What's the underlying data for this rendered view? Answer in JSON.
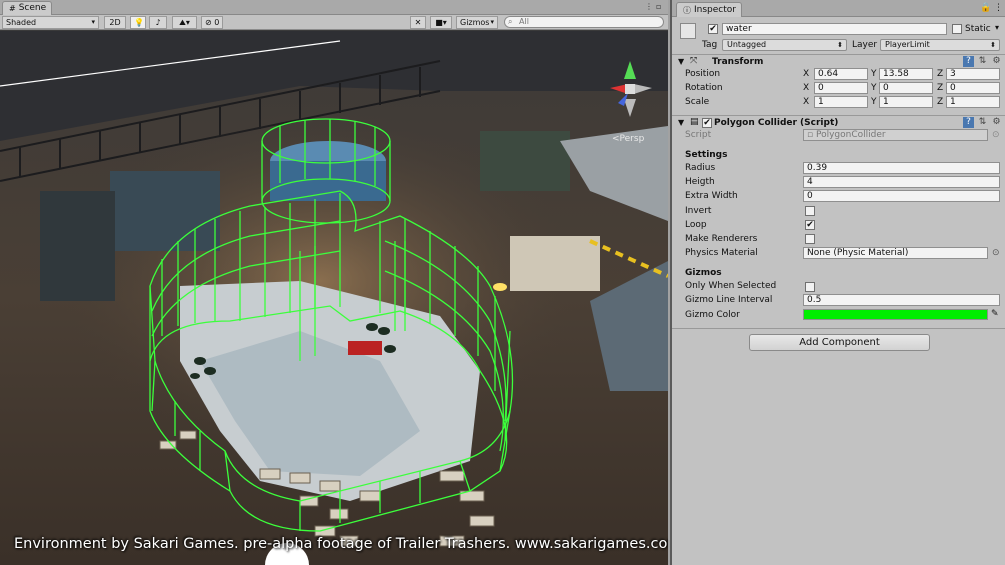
{
  "scene": {
    "tab_label": "Scene",
    "toolbar": {
      "shading_mode": "Shaded",
      "mode_2d": "2D",
      "fx_count": "0",
      "gizmos_label": "Gizmos",
      "search_placeholder": "All"
    },
    "view_label": "<Persp",
    "caption": "Environment by Sakari Games. pre-alpha footage of Trailer Trashers. www.sakarigames.com"
  },
  "inspector": {
    "tab_label": "Inspector",
    "object": {
      "active": true,
      "name": "water",
      "static_label": "Static",
      "tag_label": "Tag",
      "tag_value": "Untagged",
      "layer_label": "Layer",
      "layer_value": "PlayerLimit"
    },
    "transform": {
      "title": "Transform",
      "position_label": "Position",
      "rotation_label": "Rotation",
      "scale_label": "Scale",
      "axis_x": "X",
      "axis_y": "Y",
      "axis_z": "Z",
      "position": {
        "x": "0.64",
        "y": "13.58",
        "z": "3"
      },
      "rotation": {
        "x": "0",
        "y": "0",
        "z": "0"
      },
      "scale": {
        "x": "1",
        "y": "1",
        "z": "1"
      }
    },
    "polygon_collider": {
      "title": "Polygon Collider (Script)",
      "script_label": "Script",
      "script_value": "PolygonCollider",
      "settings_header": "Settings",
      "radius_label": "Radius",
      "radius_value": "0.39",
      "height_label": "Heigth",
      "height_value": "4",
      "extra_width_label": "Extra Width",
      "extra_width_value": "0",
      "invert_label": "Invert",
      "invert": false,
      "loop_label": "Loop",
      "loop": true,
      "make_renderers_label": "Make Renderers",
      "make_renderers": false,
      "physics_material_label": "Physics Material",
      "physics_material_value": "None (Physic Material)",
      "gizmos_header": "Gizmos",
      "only_when_selected_label": "Only When Selected",
      "only_when_selected": false,
      "line_interval_label": "Gizmo Line Interval",
      "line_interval_value": "0.5",
      "gizmo_color_label": "Gizmo Color",
      "gizmo_color": "#00ee00"
    },
    "add_component_label": "Add Component"
  },
  "colors": {
    "gizmo_green": "#3cff3c",
    "panel_bg": "#c2c2c2",
    "scene_bg": "#3a3a3a"
  }
}
